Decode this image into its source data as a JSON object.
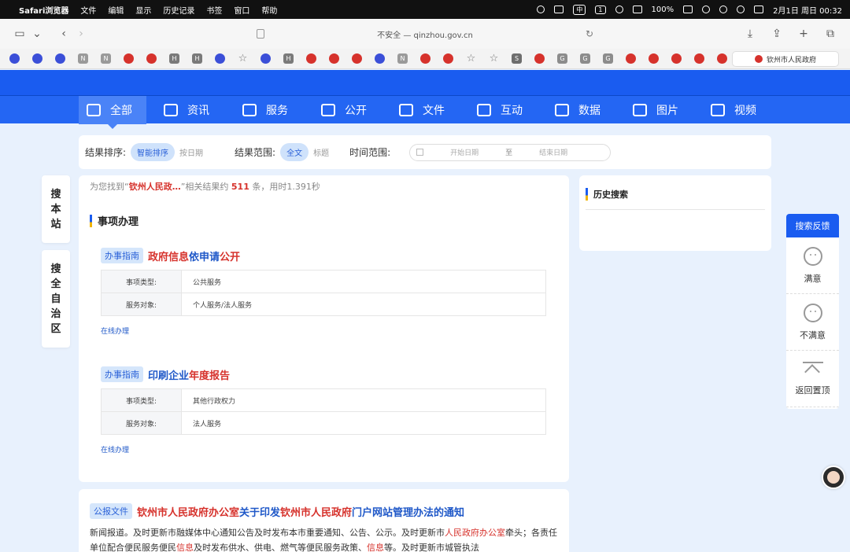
{
  "menubar": {
    "items": [
      "Safari浏览器",
      "文件",
      "编辑",
      "显示",
      "历史记录",
      "书签",
      "窗口",
      "帮助"
    ],
    "battery": "100%",
    "datetime": "2月1日 周日  00:32",
    "badge_input": "中",
    "badge_num": "1"
  },
  "browser": {
    "url": "不安全 — qinzhou.gov.cn",
    "active_tab": "钦州市人民政府"
  },
  "nav": {
    "items": [
      "全部",
      "资讯",
      "服务",
      "公开",
      "文件",
      "互动",
      "数据",
      "图片",
      "视频"
    ]
  },
  "filter": {
    "sort_label": "结果排序:",
    "sort_active": "智能排序",
    "sort_other": "按日期",
    "range_label": "结果范围:",
    "range_active": "全文",
    "range_other": "标题",
    "time_label": "时间范围:",
    "start_placeholder": "开始日期",
    "to": "至",
    "end_placeholder": "结束日期"
  },
  "side_tabs": {
    "this_site": [
      "搜",
      "本",
      "站"
    ],
    "region": [
      "搜",
      "全",
      "自",
      "治",
      "区"
    ]
  },
  "results": {
    "count_prefix": "为您找到“",
    "keyword": "钦州人民政…",
    "count_mid": "”相关结果约",
    "count": "511",
    "count_suffix": "条，用时1.391秒",
    "section_title": "事项办理",
    "items": [
      {
        "tag": "办事指南",
        "title_red1": "政府信息",
        "title_blue": "依申请",
        "title_red2": "公开",
        "row1_key": "事项类型:",
        "row1_val": "公共服务",
        "row2_key": "服务对象:",
        "row2_val": "个人服务/法人服务",
        "link": "在线办理"
      },
      {
        "tag": "办事指南",
        "title_blue": "印刷企业",
        "title_red1": "年度报告",
        "row1_key": "事项类型:",
        "row1_val": "其他行政权力",
        "row2_key": "服务对象:",
        "row2_val": "法人服务",
        "link": "在线办理"
      }
    ],
    "doc": {
      "tag": "公报文件",
      "t1": "钦州市人民政府办公室",
      "t2": "关于印发",
      "t3": "钦州市人民政府",
      "t4": "门户网站管理办法的通知",
      "b1": "新闻报道。及时更新市融媒体中心通知公告及时发布本市重要通知、公告、公示。及时更新市",
      "b2": "人民政府办公室",
      "b3": "牵头；各责任单位配合便民服务便民",
      "b4": "信息",
      "b5": "及时发布供水、供电、燃气等便民服务政策、",
      "b6": "信息",
      "b7": "等。及时更新市城管执法"
    }
  },
  "history": {
    "title": "历史搜索"
  },
  "feedback": {
    "title": "搜索反馈",
    "satisfied": "满意",
    "unsatisfied": "不满意",
    "back_top": "返回置顶"
  },
  "colors": {
    "brand_blue": "#1a5cf0",
    "highlight_red": "#d6322c"
  }
}
